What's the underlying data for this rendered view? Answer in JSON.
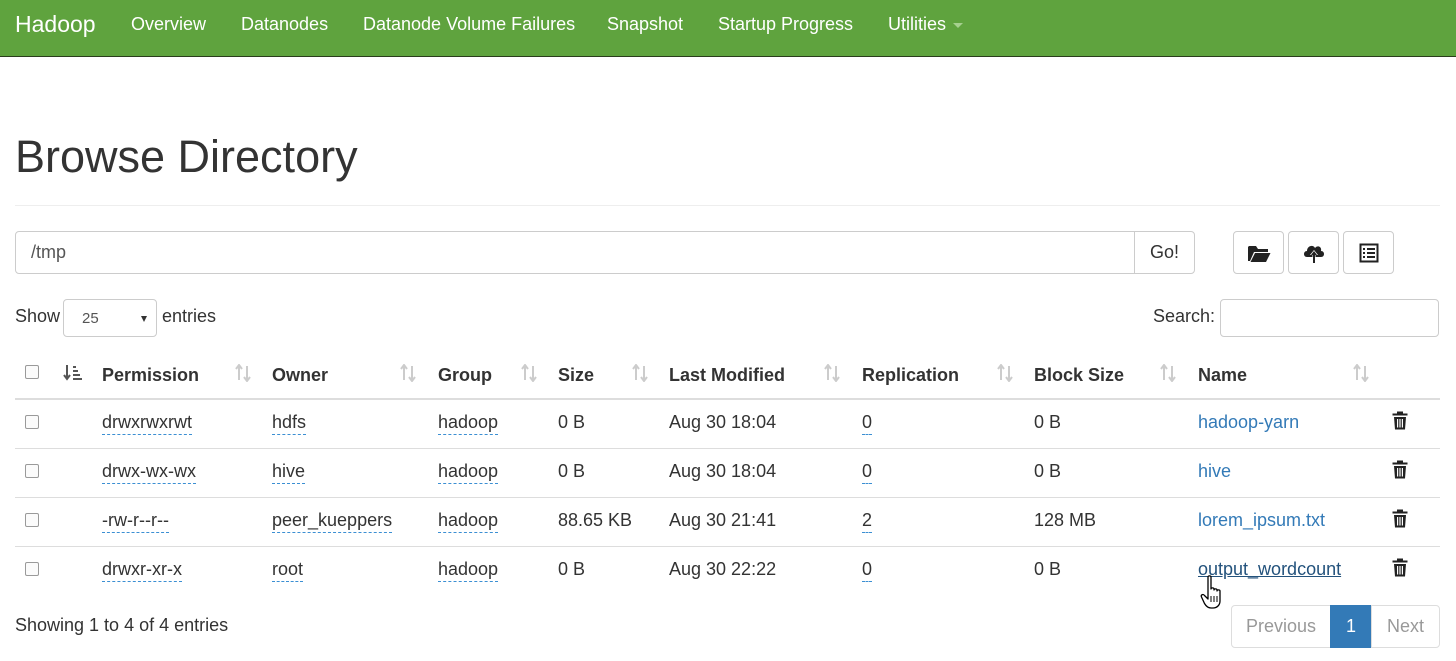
{
  "navbar": {
    "brand": "Hadoop",
    "items": [
      "Overview",
      "Datanodes",
      "Datanode Volume Failures",
      "Snapshot",
      "Startup Progress",
      "Utilities"
    ],
    "color": "#5fa33e"
  },
  "page": {
    "title": "Browse Directory"
  },
  "path": {
    "value": "/tmp",
    "go_label": "Go!"
  },
  "toolbar": {
    "icons": [
      "folder-open-icon",
      "cloud-upload-icon",
      "list-alt-icon"
    ]
  },
  "controls": {
    "show_label": "Show",
    "entries_value": "25",
    "entries_label": "entries",
    "search_label": "Search:"
  },
  "table": {
    "columns": [
      "Permission",
      "Owner",
      "Group",
      "Size",
      "Last Modified",
      "Replication",
      "Block Size",
      "Name"
    ],
    "rows": [
      {
        "permission": "drwxrwxrwt",
        "owner": "hdfs",
        "group": "hadoop",
        "size": "0 B",
        "modified": "Aug 30 18:04",
        "replication": "0",
        "block_size": "0 B",
        "name": "hadoop-yarn"
      },
      {
        "permission": "drwx-wx-wx",
        "owner": "hive",
        "group": "hadoop",
        "size": "0 B",
        "modified": "Aug 30 18:04",
        "replication": "0",
        "block_size": "0 B",
        "name": "hive"
      },
      {
        "permission": "-rw-r--r--",
        "owner": "peer_kueppers",
        "group": "hadoop",
        "size": "88.65 KB",
        "modified": "Aug 30 21:41",
        "replication": "2",
        "block_size": "128 MB",
        "name": "lorem_ipsum.txt"
      },
      {
        "permission": "drwxr-xr-x",
        "owner": "root",
        "group": "hadoop",
        "size": "0 B",
        "modified": "Aug 30 22:22",
        "replication": "0",
        "block_size": "0 B",
        "name": "output_wordcount"
      }
    ]
  },
  "footer": {
    "info": "Showing 1 to 4 of 4 entries",
    "prev_label": "Previous",
    "current_page": "1",
    "next_label": "Next"
  },
  "colors": {
    "link": "#337ab7",
    "active_page": "#337ab7"
  }
}
